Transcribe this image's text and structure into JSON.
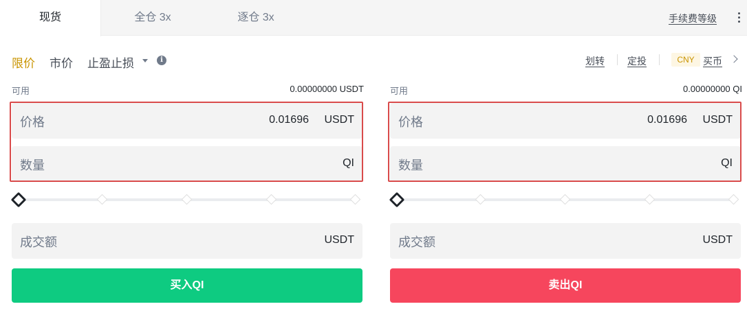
{
  "tabs": [
    {
      "label": "现货",
      "active": true
    },
    {
      "label": "全仓 3x",
      "active": false
    },
    {
      "label": "逐仓 3x",
      "active": false
    }
  ],
  "fee_level_link": "手续费等级",
  "order_types": {
    "limit": "限价",
    "market": "市价",
    "stop": "止盈止损",
    "active": "limit"
  },
  "right_links": {
    "transfer": "划转",
    "invest": "定投",
    "currency_badge": "CNY",
    "buy_crypto": "买币"
  },
  "buy_panel": {
    "available_label": "可用",
    "available_value": "0.00000000 USDT",
    "price_label": "价格",
    "price_value": "0.01696",
    "price_unit": "USDT",
    "amount_label": "数量",
    "amount_unit": "QI",
    "slider_percent": 0,
    "total_label": "成交额",
    "total_unit": "USDT",
    "button_label": "买入QI"
  },
  "sell_panel": {
    "available_label": "可用",
    "available_value": "0.00000000 QI",
    "price_label": "价格",
    "price_value": "0.01696",
    "price_unit": "USDT",
    "amount_label": "数量",
    "amount_unit": "QI",
    "slider_percent": 0,
    "total_label": "成交额",
    "total_unit": "USDT",
    "button_label": "卖出QI"
  },
  "colors": {
    "accent": "#c99400",
    "buy": "#0ecb81",
    "sell": "#f6465d",
    "highlight_box": "#d94a4a"
  }
}
